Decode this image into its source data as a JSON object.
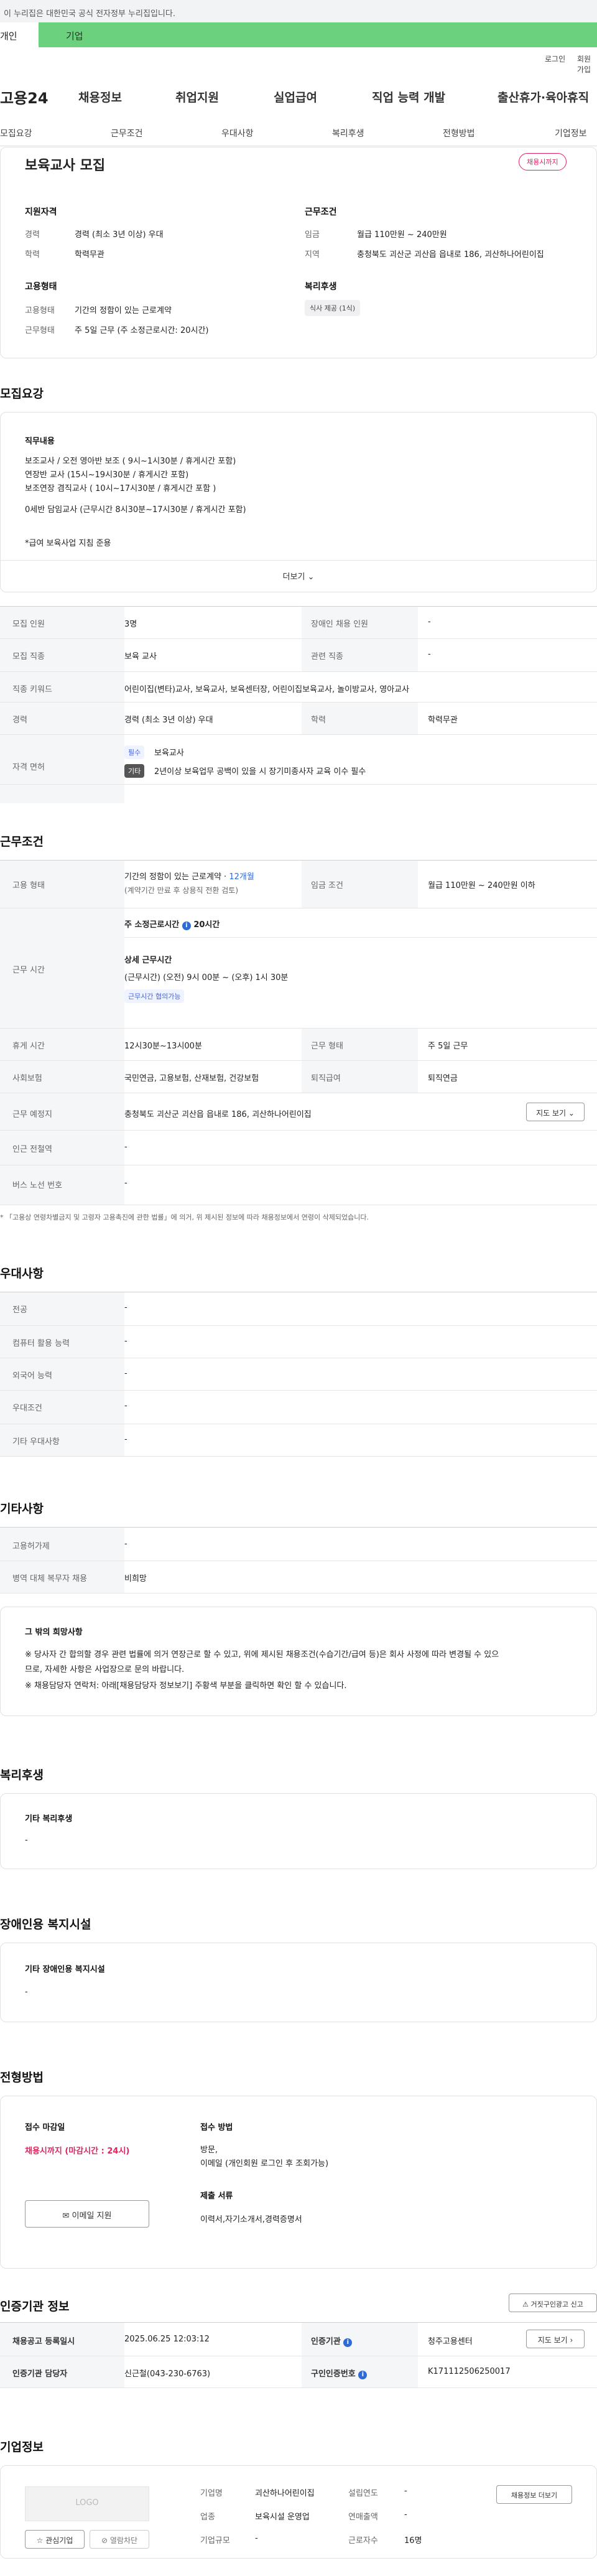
{
  "gov": {
    "notice": "이 누리집은 대한민국 공식 전자정부 누리집입니다."
  },
  "persona_tabs": {
    "personal": "개인",
    "company": "기업"
  },
  "util": {
    "login": "로그인",
    "signup": "회원가입"
  },
  "brand": {
    "name": "고용24"
  },
  "gnb": [
    "채용정보",
    "취업지원",
    "실업급여",
    "직업 능력 개발",
    "출산휴가·육아휴직"
  ],
  "subnav": [
    "모집요강",
    "근무조건",
    "우대사항",
    "복리후생",
    "전형방법",
    "기업정보"
  ],
  "summary": {
    "title": "보육교사 모집",
    "status": "채용시까지",
    "qual_h": "지원자격",
    "cond_h": "근무조건",
    "emp_h": "고용형태",
    "welfare_h": "복리후생",
    "career_l": "경력",
    "career_v": "경력 (최소 3년 이상) 우대",
    "edu_l": "학력",
    "edu_v": "학력무관",
    "wage_l": "임금",
    "wage_v": "월급 110만원 ~ 240만원",
    "area_l": "지역",
    "area_v": "충청북도 괴산군 괴산읍 읍내로 186, 괴산하나어린이집",
    "type_l": "고용형태",
    "type_v": "기간의 정함이 있는 근로계약",
    "work_l": "근무형태",
    "work_v": "주 5일 근무 (주 소정근로시간: 20시간)",
    "welfare_chip": "식사 제공 (1식)"
  },
  "recruit": {
    "heading": "모집요강",
    "duty_h": "직무내용",
    "duty_lines": [
      "보조교사 / 오전 영아반 보조 ( 9시~1시30분 / 휴게시간 포함)",
      "연장반 교사 (15시~19시30분 / 휴게시간 포함)",
      "보조연장 겸직교사 ( 10시~17시30분 / 휴게시간 포함 )",
      "",
      "0세반 담임교사 (근무시간 8시30분~17시30분 / 휴게시간 포함)"
    ],
    "duty_note": "*급여 보육사업 지침 준용",
    "more": "더보기",
    "rows": [
      {
        "l1": "모집 인원",
        "v1": "3명",
        "l2": "장애인 채용 인원",
        "v2": "-"
      },
      {
        "l1": "모집 직종",
        "v1": "보육 교사",
        "l2": "관련 직종",
        "v2": "-"
      }
    ],
    "kw_l": "직종 키워드",
    "kw_v": "어린이집(변타)교사, 보육교사, 보육센터장, 어린이집보육교사, 놀이방교사, 영아교사",
    "career_l": "경력",
    "career_v": "경력 (최소 3년 이상) 우대",
    "edu_l": "학력",
    "edu_v": "학력무관",
    "lic_l": "자격 면허",
    "lic_chip1": "필수",
    "lic_v1": "보육교사",
    "lic_chip2": "기타",
    "lic_v2": "2년이상 보육업무 공백이 있을 시 장기미종사자 교육 이수 필수"
  },
  "conditions": {
    "heading": "근무조건",
    "emp_l": "고용 형태",
    "emp_v1": "기간의 정함이 있는 근로계약 · ",
    "emp_months": "12개월",
    "emp_v2": "(계약기간 만료 후 상용직 전환 검토)",
    "wage_l": "임금 조건",
    "wage_v": "월급 110만원 ~ 240만원 이하",
    "time_l": "근무 시간",
    "time_week": "주 소정근로시간",
    "time_week_v": "20시간",
    "time_detail_h": "상세 근무시간",
    "time_detail_v": "(근무시간) (오전) 9시 00분 ~ (오후) 1시 30분",
    "time_chip": "근무시간 협의가능",
    "break_l": "휴게 시간",
    "break_v": "12시30분~13시00분",
    "form_l": "근무 형태",
    "form_v": "주 5일 근무",
    "ins_l": "사회보험",
    "ins_v": "국민연금, 고용보험, 산재보험, 건강보험",
    "ret_l": "퇴직급여",
    "ret_v": "퇴직연금",
    "place_l": "근무 예정지",
    "place_v": "충청북도 괴산군 괴산읍 읍내로 186, 괴산하나어린이집",
    "map_btn": "지도 보기",
    "subway_l": "인근 전철역",
    "subway_v": "-",
    "bus_l": "버스 노선 번호",
    "bus_v": "-",
    "footnote": "* 「고용상 연령차별금지 및 고령자 고용촉진에 관한 법률」에 의거, 위 제시된 정보에 따라 채용정보에서 연령이 삭제되었습니다."
  },
  "preference": {
    "heading": "우대사항",
    "rows": [
      {
        "l": "전공",
        "v": "-"
      },
      {
        "l": "컴퓨터 활용 능력",
        "v": "-"
      },
      {
        "l": "외국어 능력",
        "v": "-"
      },
      {
        "l": "우대조건",
        "v": "-"
      },
      {
        "l": "기타 우대사항",
        "v": "-"
      }
    ]
  },
  "others": {
    "heading": "기타사항",
    "rows": [
      {
        "l": "고용허가제",
        "v": "-"
      },
      {
        "l": "병역 대체 복무자 채용",
        "v": "비희망"
      }
    ],
    "box_h": "그 밖의 희망사항",
    "box_l1": "※ 당사자 간 합의할 경우 관련 법률에 의거 연장근로 할 수 있고, 위에 제시된 채용조건(수습기간/급여 등)은 회사 사정에 따라 변경될 수 있으",
    "box_l2": "므로, 자세한 사항은 사업장으로 문의 바랍니다.",
    "box_l3": "※ 채용담당자 연락처: 아래[채용담당자 정보보기] 주황색 부분을 클릭하면 확인 할 수 있습니다."
  },
  "welfare": {
    "heading": "복리후생",
    "box_h": "기타 복리후생",
    "box_v": "-"
  },
  "disabled": {
    "heading": "장애인용 복지시설",
    "box_h": "기타 장애인용 복지시설",
    "box_v": "-"
  },
  "selection": {
    "heading": "전형방법",
    "deadline_h": "접수 마감일",
    "deadline_v": "채용시까지 (마감시간 : 24시)",
    "email_btn": "이메일 지원",
    "method_h": "접수 방법",
    "method_v1": "방문,",
    "method_v2": "이메일 (개인회원 로그인 후 조회가능)",
    "docs_h": "제출 서류",
    "docs_v": "이력서,자기소개서,경력증명서"
  },
  "agency": {
    "heading": "인증기관 정보",
    "report_btn": "거짓구인광고 신고",
    "date_l": "채용공고 등록일시",
    "date_v": "2025.06.25 12:03:12",
    "org_l": "인증기관",
    "org_v": "청주고용센터",
    "map_btn": "지도 보기",
    "mgr_l": "인증기관 담당자",
    "mgr_v": "신근철(043-230-6763)",
    "no_l": "구인인증번호",
    "no_v": "K171112506250017"
  },
  "company": {
    "heading": "기업정보",
    "logo": "LOGO",
    "fav_btn": "관심기업",
    "block_btn": "열람차단",
    "name_l": "기업명",
    "name_v": "괴산하나어린이집",
    "year_l": "설립연도",
    "year_v": "-",
    "ind_l": "업종",
    "ind_v": "보육시설 운영업",
    "sales_l": "연매출액",
    "sales_v": "-",
    "size_l": "기업규모",
    "size_v": "-",
    "emp_l": "근로자수",
    "emp_v": "16명",
    "jobs_btn": "채용정보 더보기"
  }
}
